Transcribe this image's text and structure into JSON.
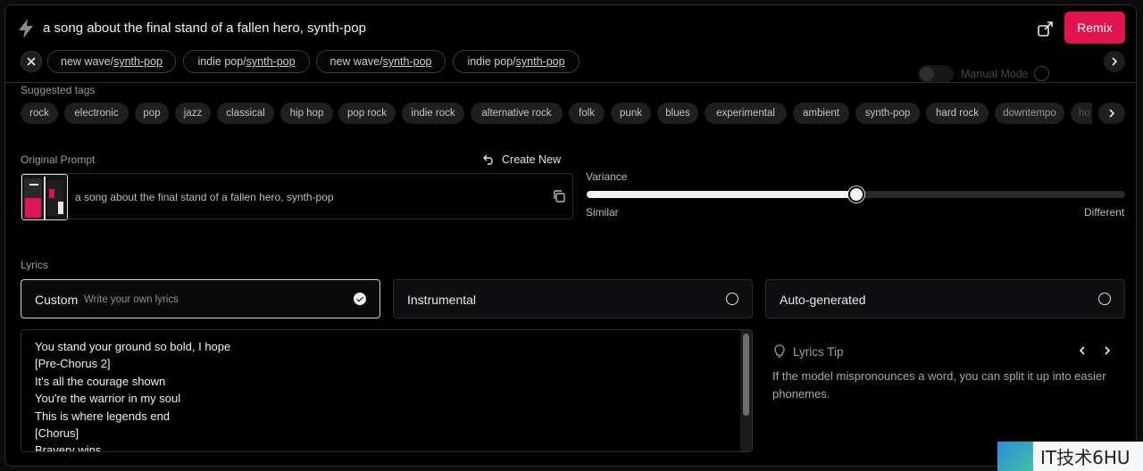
{
  "header": {
    "prompt_title": "a song about the final stand of a fallen hero, synth-pop",
    "remix_label": "Remix",
    "icons": {
      "app": "bolt-icon",
      "share": "share-icon"
    }
  },
  "style_chips": [
    {
      "prefix": "new wave/",
      "link": "synth-pop"
    },
    {
      "prefix": "indie pop/",
      "link": "synth-pop"
    },
    {
      "prefix": "new wave/",
      "link": "synth-pop"
    },
    {
      "prefix": "indie pop/",
      "link": "synth-pop"
    }
  ],
  "manual_mode": {
    "label": "Manual Mode",
    "enabled": false
  },
  "suggested_tags": {
    "label": "Suggested tags",
    "items": [
      "rock",
      "electronic",
      "pop",
      "jazz",
      "classical",
      "hip hop",
      "pop rock",
      "indie rock",
      "alternative rock",
      "folk",
      "punk",
      "blues",
      "experimental",
      "ambient",
      "synth-pop",
      "hard rock",
      "downtempo",
      "ho"
    ]
  },
  "original_prompt": {
    "label": "Original Prompt",
    "create_new_label": "Create New",
    "text": "a song about the final stand of a fallen hero, synth-pop"
  },
  "variance": {
    "label": "Variance",
    "min_label": "Similar",
    "max_label": "Different",
    "value_fraction": 0.5
  },
  "lyrics": {
    "label": "Lyrics",
    "options": [
      {
        "label": "Custom",
        "sub": "Write your own lyrics",
        "selected": true
      },
      {
        "label": "Instrumental",
        "sub": "",
        "selected": false
      },
      {
        "label": "Auto-generated",
        "sub": "",
        "selected": false
      }
    ],
    "lines": [
      "You stand your ground so bold, I hope",
      "[Pre-Chorus 2]",
      "It's all the courage shown",
      "You're the warrior in my soul",
      "This is where legends end",
      "[Chorus]",
      "Bravery wins"
    ]
  },
  "tip": {
    "title": "Lyrics Tip",
    "text": "If the model mispronounces a word, you can split it up into easier phonemes."
  },
  "watermark": {
    "text": "IT技术6HU"
  },
  "colors": {
    "accent": "#e1134d",
    "background": "#000000",
    "chip_bg": "#1f1f21"
  }
}
